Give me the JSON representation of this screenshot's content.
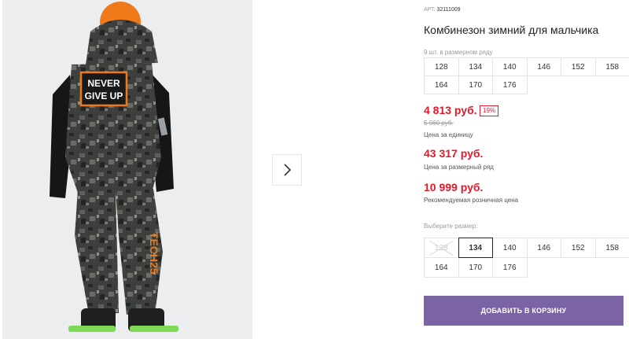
{
  "product": {
    "sku_label": "АРТ.",
    "sku": "32111009",
    "title": "Комбинезон зимний для мальчика",
    "pack_note": "9 шт. в размерном ряду"
  },
  "pack_sizes": [
    "128",
    "134",
    "140",
    "146",
    "152",
    "158",
    "164",
    "170",
    "176"
  ],
  "pricing": {
    "price": "4 813 руб.",
    "discount": "19%",
    "old_price": "5 960 руб.",
    "unit_label": "Цена за единицу",
    "range_price": "43 317 руб.",
    "range_label": "Цена за размерный ряд",
    "retail_price": "10 999 руб.",
    "retail_label": "Рекомендуемая розничная цена"
  },
  "size_select": {
    "prompt": "Выберите размер:",
    "options": [
      {
        "label": "128",
        "state": "unavailable"
      },
      {
        "label": "134",
        "state": "selected"
      },
      {
        "label": "140",
        "state": "available"
      },
      {
        "label": "146",
        "state": "available"
      },
      {
        "label": "152",
        "state": "available"
      },
      {
        "label": "158",
        "state": "available"
      },
      {
        "label": "164",
        "state": "available"
      },
      {
        "label": "170",
        "state": "available"
      },
      {
        "label": "176",
        "state": "available"
      }
    ]
  },
  "cart": {
    "button_label": "ДОБАВИТЬ В КОРЗИНУ"
  },
  "gallery": {
    "patch_line1": "NEVER",
    "patch_line2": "GIVE UP",
    "leg_print": "TECH25",
    "next_icon": "chevron-right-icon"
  },
  "colors": {
    "price": "#e21a2c",
    "button": "#7b64a4",
    "accent_orange": "#f07a1a"
  }
}
